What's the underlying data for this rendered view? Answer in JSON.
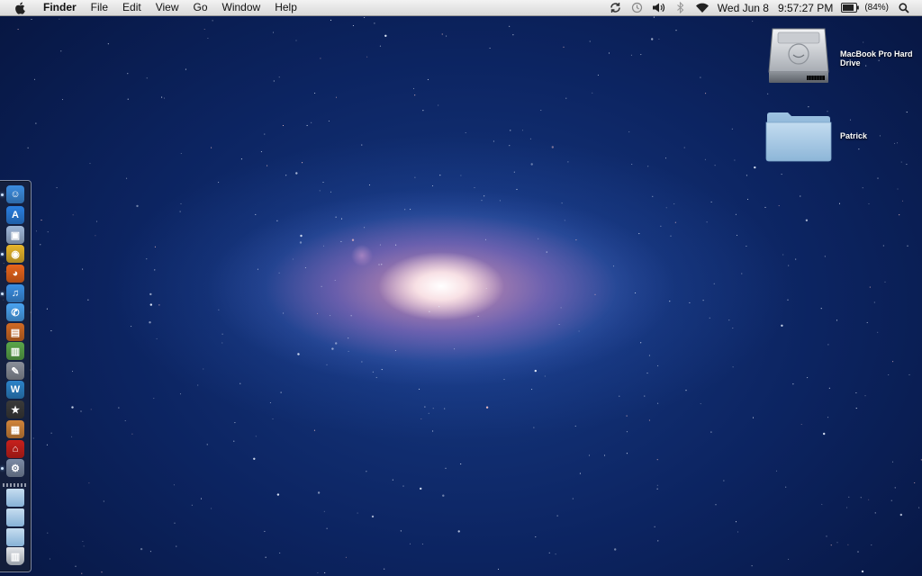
{
  "menubar": {
    "app_name": "Finder",
    "menus": [
      "File",
      "Edit",
      "View",
      "Go",
      "Window",
      "Help"
    ],
    "status": {
      "date": "Wed Jun 8",
      "time": "9:57:27 PM",
      "battery": "(84%)"
    }
  },
  "desktop": {
    "icons": [
      {
        "label": "MacBook Pro Hard Drive",
        "icon": "hard-drive-icon"
      },
      {
        "label": "Patrick",
        "icon": "folder-icon"
      }
    ]
  },
  "dock": {
    "items": [
      {
        "name": "finder",
        "icon": "finder-icon",
        "color": "#3c8de0",
        "running": true
      },
      {
        "name": "app-store",
        "icon": "app-store-icon",
        "color": "#2a7fe0",
        "running": false
      },
      {
        "name": "preview",
        "icon": "preview-icon",
        "color": "#9fb7d8",
        "running": false
      },
      {
        "name": "chrome",
        "icon": "chrome-icon",
        "color": "#e8b62c",
        "running": true
      },
      {
        "name": "firefox",
        "icon": "firefox-icon",
        "color": "#e8651c",
        "running": false
      },
      {
        "name": "itunes",
        "icon": "itunes-icon",
        "color": "#3a8fe3",
        "running": true
      },
      {
        "name": "ichat",
        "icon": "ichat-icon",
        "color": "#4aa3f0",
        "running": false
      },
      {
        "name": "keynote",
        "icon": "keynote-icon",
        "color": "#d06a24",
        "running": false
      },
      {
        "name": "numbers",
        "icon": "numbers-icon",
        "color": "#5aa64a",
        "running": false
      },
      {
        "name": "script-editor",
        "icon": "script-editor-icon",
        "color": "#8a8f9a",
        "running": false
      },
      {
        "name": "word",
        "icon": "word-icon",
        "color": "#2c83c9",
        "running": false
      },
      {
        "name": "imovie",
        "icon": "imovie-icon",
        "color": "#3a3a3a",
        "running": false
      },
      {
        "name": "iphoto",
        "icon": "iphoto-icon",
        "color": "#d0843a",
        "running": false
      },
      {
        "name": "acrobat",
        "icon": "acrobat-icon",
        "color": "#c8201c",
        "running": false
      },
      {
        "name": "system-preferences",
        "icon": "system-preferences-icon",
        "color": "#7b8aa4",
        "running": true
      },
      {
        "name": "applications-stack",
        "icon": "folder-icon",
        "color": "#7fb2dc",
        "running": false
      },
      {
        "name": "documents-stack",
        "icon": "folder-icon",
        "color": "#7fb2dc",
        "running": false
      },
      {
        "name": "downloads-stack",
        "icon": "folder-icon",
        "color": "#7fb2dc",
        "running": false
      },
      {
        "name": "trash",
        "icon": "trash-icon",
        "color": "#b8bcc4",
        "running": false
      }
    ]
  }
}
